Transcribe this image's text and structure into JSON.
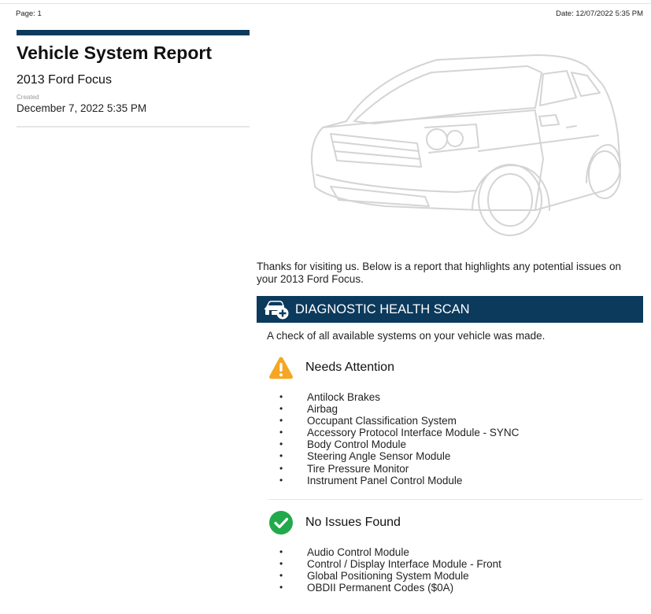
{
  "header": {
    "page": "Page: 1",
    "date": "Date: 12/07/2022 5:35 PM"
  },
  "report": {
    "title": "Vehicle System Report",
    "vehicle": "2013 Ford Focus",
    "created_label": "Created",
    "created_date": "December 7, 2022 5:35 PM"
  },
  "intro": "Thanks for visiting us. Below is a report that highlights any potential issues on your 2013 Ford Focus.",
  "scan": {
    "title": "DIAGNOSTIC HEALTH SCAN",
    "icon": "car-health-icon",
    "description": "A check of all available systems on your vehicle was made."
  },
  "needs_attention": {
    "label": "Needs Attention",
    "icon": "warning-triangle-icon",
    "color": "#f5a623",
    "items": [
      "Antilock Brakes",
      "Airbag",
      "Occupant Classification System",
      "Accessory Protocol Interface Module - SYNC",
      "Body Control Module",
      "Steering Angle Sensor Module",
      "Tire Pressure Monitor",
      "Instrument Panel Control Module"
    ]
  },
  "no_issues": {
    "label": "No Issues Found",
    "icon": "check-circle-icon",
    "color": "#22a94b",
    "items": [
      "Audio Control Module",
      "Control / Display Interface Module - Front",
      "Global Positioning System Module",
      "OBDII Permanent Codes ($0A)"
    ]
  },
  "colors": {
    "accent": "#0b3a5c"
  },
  "bullet": "•"
}
